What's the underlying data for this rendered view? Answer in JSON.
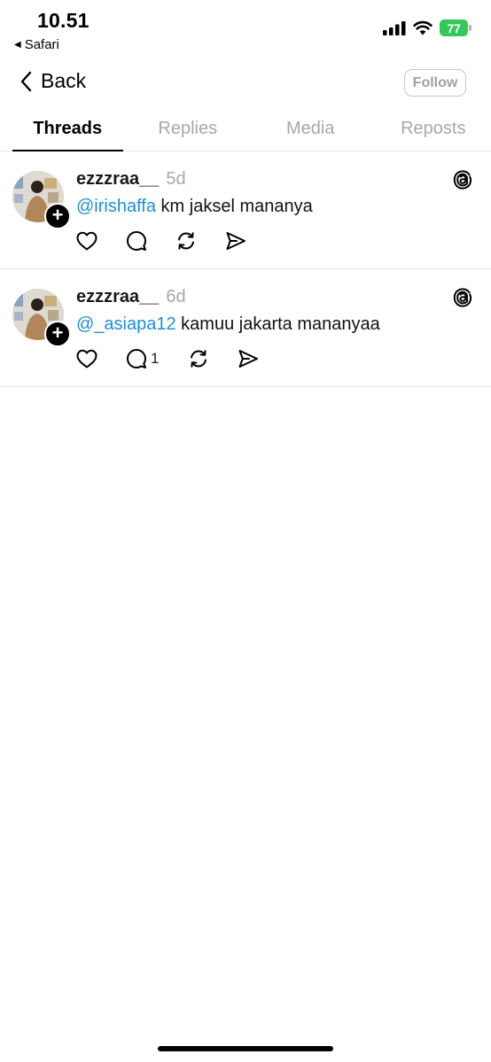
{
  "status_bar": {
    "time": "10.51",
    "back_app": "Safari",
    "battery": "77",
    "battery_color": "#34c759"
  },
  "nav": {
    "back_label": "Back",
    "follow_label": "Follow"
  },
  "tabs": [
    {
      "label": "Threads",
      "active": true
    },
    {
      "label": "Replies",
      "active": false
    },
    {
      "label": "Media",
      "active": false
    },
    {
      "label": "Reposts",
      "active": false
    }
  ],
  "posts": [
    {
      "username": "ezzzraa__",
      "time": "5d",
      "mention": "@irishaffa",
      "text": " km jaksel mananya",
      "reply_count": ""
    },
    {
      "username": "ezzzraa__",
      "time": "6d",
      "mention": "@_asiapa12",
      "text": " kamuu jakarta mananyaa",
      "reply_count": "1"
    }
  ],
  "icons": {
    "like": "heart-icon",
    "reply": "comment-icon",
    "repost": "repost-icon",
    "share": "send-icon",
    "app": "threads-logo-icon"
  },
  "colors": {
    "mention": "#1d8fd6",
    "muted": "#a8a8a8"
  }
}
